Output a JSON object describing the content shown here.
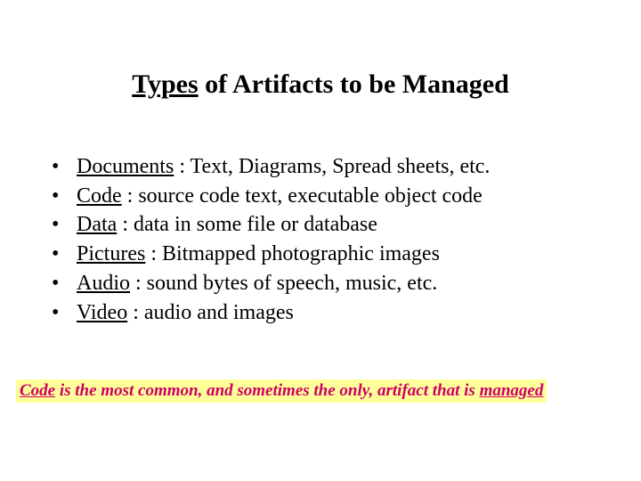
{
  "title": {
    "underlined": "Types",
    "rest": " of Artifacts to be Managed"
  },
  "bullets": [
    {
      "term": "Documents",
      "rest": " : Text, Diagrams, Spread sheets, etc."
    },
    {
      "term": "Code",
      "rest": " : source code text, executable object code"
    },
    {
      "term": "Data",
      "rest": " : data in some file or database"
    },
    {
      "term": "Pictures",
      "rest": " : Bitmapped photographic images"
    },
    {
      "term": "Audio",
      "rest": " : sound bytes of speech, music, etc."
    },
    {
      "term": "Video",
      "rest": " : audio and images"
    }
  ],
  "footnote": {
    "u1": "Code",
    "mid": " is the most common, and sometimes the only, artifact that is ",
    "u2": "managed"
  }
}
